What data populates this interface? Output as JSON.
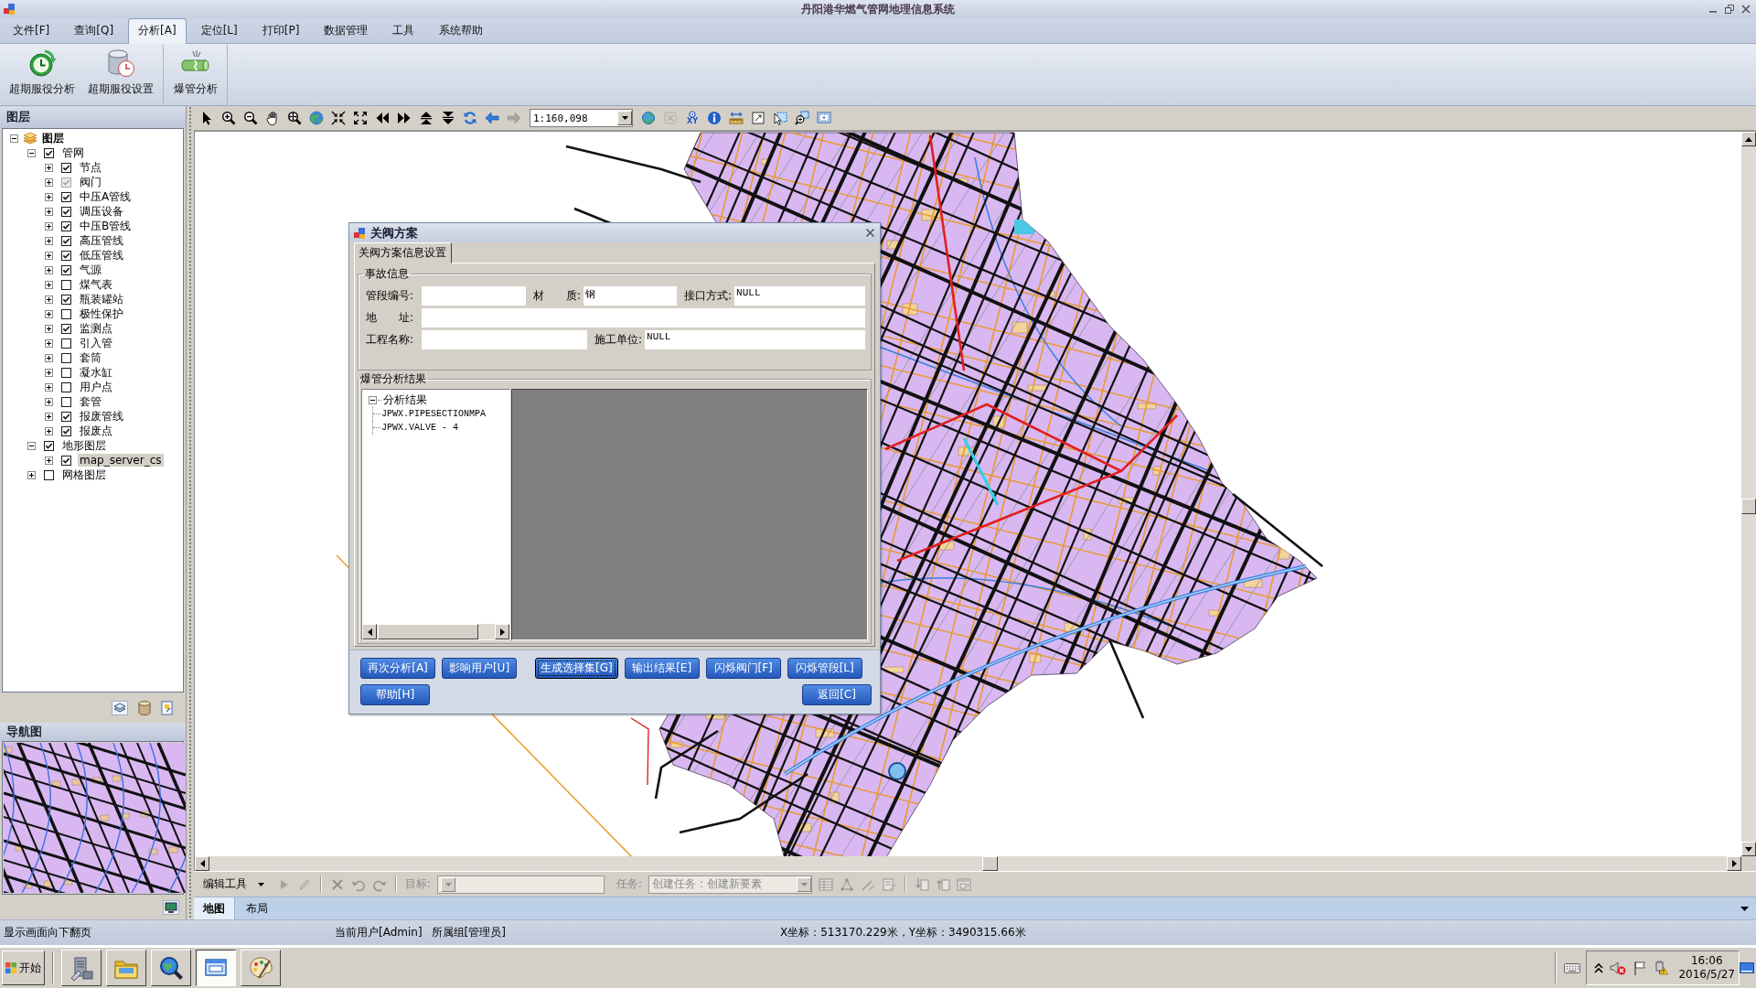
{
  "window": {
    "title": "丹阳港华燃气管网地理信息系统"
  },
  "menu": {
    "tabs": [
      {
        "label": "文件[F]",
        "selected": false
      },
      {
        "label": "查询[Q]",
        "selected": false
      },
      {
        "label": "分析[A]",
        "selected": true
      },
      {
        "label": "定位[L]",
        "selected": false
      },
      {
        "label": "打印[P]",
        "selected": false
      },
      {
        "label": "数据管理",
        "selected": false
      },
      {
        "label": "工具",
        "selected": false
      },
      {
        "label": "系统帮助",
        "selected": false
      }
    ]
  },
  "ribbon": {
    "groups": [
      {
        "buttons": [
          {
            "label": "超期服役分析"
          },
          {
            "label": "超期服役设置"
          }
        ]
      },
      {
        "buttons": [
          {
            "label": "爆管分析"
          }
        ]
      }
    ]
  },
  "layers_panel": {
    "title": "图层",
    "tree": {
      "label": "图层",
      "expanded": true,
      "children": [
        {
          "label": "管网",
          "checked": true,
          "disabled": false,
          "expanded": true,
          "selected": false,
          "children": [
            {
              "label": "节点",
              "checked": true,
              "disabled": false,
              "expanded": false,
              "selected": false
            },
            {
              "label": "阀门",
              "checked": true,
              "disabled": true,
              "expanded": false,
              "selected": false
            },
            {
              "label": "中压A管线",
              "checked": true,
              "disabled": false,
              "expanded": false,
              "selected": false
            },
            {
              "label": "调压设备",
              "checked": true,
              "disabled": false,
              "expanded": false,
              "selected": false
            },
            {
              "label": "中压B管线",
              "checked": true,
              "disabled": false,
              "expanded": false,
              "selected": false
            },
            {
              "label": "高压管线",
              "checked": true,
              "disabled": false,
              "expanded": false,
              "selected": false
            },
            {
              "label": "低压管线",
              "checked": true,
              "disabled": false,
              "expanded": false,
              "selected": false
            },
            {
              "label": "气源",
              "checked": true,
              "disabled": false,
              "expanded": false,
              "selected": false
            },
            {
              "label": "煤气表",
              "checked": false,
              "disabled": false,
              "expanded": false,
              "selected": false
            },
            {
              "label": "瓶装罐站",
              "checked": true,
              "disabled": false,
              "expanded": false,
              "selected": false
            },
            {
              "label": "极性保护",
              "checked": false,
              "disabled": false,
              "expanded": false,
              "selected": false
            },
            {
              "label": "监测点",
              "checked": true,
              "disabled": false,
              "expanded": false,
              "selected": false
            },
            {
              "label": "引入管",
              "checked": false,
              "disabled": false,
              "expanded": false,
              "selected": false
            },
            {
              "label": "套筒",
              "checked": false,
              "disabled": false,
              "expanded": false,
              "selected": false
            },
            {
              "label": "凝水缸",
              "checked": false,
              "disabled": false,
              "expanded": false,
              "selected": false
            },
            {
              "label": "用户点",
              "checked": false,
              "disabled": false,
              "expanded": false,
              "selected": false
            },
            {
              "label": "套管",
              "checked": false,
              "disabled": false,
              "expanded": false,
              "selected": false
            },
            {
              "label": "报废管线",
              "checked": true,
              "disabled": false,
              "expanded": false,
              "selected": false
            },
            {
              "label": "报废点",
              "checked": true,
              "disabled": false,
              "expanded": false,
              "selected": false
            }
          ]
        },
        {
          "label": "地形图层",
          "checked": true,
          "disabled": false,
          "expanded": true,
          "selected": false,
          "children": [
            {
              "label": "map_server_cs",
              "checked": true,
              "disabled": false,
              "expanded": false,
              "selected": true
            }
          ]
        },
        {
          "label": "网格图层",
          "checked": false,
          "disabled": false,
          "expanded": false,
          "selected": false
        }
      ]
    }
  },
  "navigation_panel": {
    "title": "导航图"
  },
  "map_toolbar": {
    "tools_left": [
      {
        "disabled": false
      },
      {
        "disabled": false
      },
      {
        "disabled": false
      },
      {
        "disabled": false
      },
      {
        "disabled": false
      },
      {
        "disabled": false
      },
      {
        "disabled": false
      },
      {
        "disabled": false
      },
      {
        "disabled": false
      },
      {
        "disabled": false
      },
      {
        "disabled": false
      },
      {
        "disabled": false
      },
      {
        "disabled": false
      },
      {
        "disabled": false
      },
      {
        "disabled": true
      }
    ],
    "scale": "1:160,098",
    "tools_right": [
      {
        "disabled": false
      },
      {
        "disabled": true
      },
      {
        "disabled": false,
        "label": "XY"
      },
      {
        "disabled": false
      },
      {
        "disabled": false
      },
      {
        "disabled": false
      },
      {
        "disabled": false
      },
      {
        "disabled": false
      },
      {
        "disabled": false
      }
    ]
  },
  "dialog": {
    "title": "关阀方案",
    "tabs": [
      {
        "label": "关阀方案信息设置",
        "selected": true
      }
    ],
    "incident_group": {
      "title": "事故信息",
      "rows": [
        {
          "fields": [
            {
              "label": "管段编号:"
            },
            {
              "label": "材　　质:",
              "value": "钢"
            },
            {
              "label": "接口方式:",
              "value": "NULL"
            }
          ]
        },
        {
          "fields": [
            {
              "label": "地　　址:"
            }
          ]
        },
        {
          "fields": [
            {
              "label": "工程名称:"
            },
            {
              "label": "施工单位:",
              "value": "NULL"
            }
          ]
        }
      ]
    },
    "results_group": {
      "title": "爆管分析结果",
      "tree": {
        "label": "分析结果",
        "expanded": true,
        "children": [
          {
            "label": "JPWX.PIPESECTIONMPA"
          },
          {
            "label": "JPWX.VALVE - 4"
          }
        ]
      }
    },
    "button_rows": [
      {
        "buttons": [
          {
            "label": "再次分析[A]",
            "focused": false
          },
          {
            "label": "影响用户[U]",
            "focused": false
          },
          {
            "label": "生成选择集[G]",
            "focused": true
          },
          {
            "label": "输出结果[E]",
            "focused": false
          },
          {
            "label": "闪烁阀门[F]",
            "focused": false
          },
          {
            "label": "闪烁管段[L]",
            "focused": false
          }
        ]
      },
      {
        "buttons": [
          {
            "label": "帮助[H]",
            "focused": false
          },
          {
            "label": "返回[C]",
            "focused": false
          }
        ]
      }
    ]
  },
  "edit_toolbar": {
    "menu_label": "编辑工具",
    "tools_left": [
      {
        "disabled": true
      },
      {
        "disabled": true
      },
      {
        "disabled": true
      },
      {
        "disabled": true
      },
      {
        "disabled": true
      }
    ],
    "target_label": "目标:",
    "target_field": {
      "disabled": true
    },
    "task_label": "任务:",
    "task_field": {
      "value": "创建任务 : 创建新要素",
      "disabled": true
    },
    "tools_right": [
      {
        "disabled": true
      },
      {
        "disabled": true
      },
      {
        "disabled": true
      },
      {
        "disabled": true
      },
      {
        "disabled": true
      },
      {
        "disabled": true
      },
      {
        "disabled": true
      }
    ]
  },
  "view_tabs": {
    "tabs": [
      {
        "label": "地图",
        "selected": true
      },
      {
        "label": "布局",
        "selected": false
      }
    ]
  },
  "status_bar": {
    "message": "显示画面向下翻页",
    "user": "当前用户[Admin]",
    "group": "所属组[管理员]",
    "coordinates": "X坐标：513170.229米，Y坐标：3490315.66米"
  },
  "taskbar": {
    "start_label": "开始",
    "apps": [
      {
        "active": false
      },
      {
        "active": false
      },
      {
        "active": false
      },
      {
        "active": true
      },
      {
        "active": false
      }
    ],
    "clock": {
      "time": "16:06",
      "date": "2016/5/27"
    }
  }
}
